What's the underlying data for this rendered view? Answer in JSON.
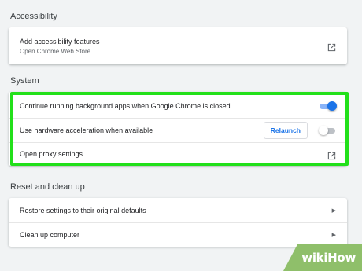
{
  "accessibility": {
    "heading": "Accessibility",
    "add_features": {
      "label": "Add accessibility features",
      "sublabel": "Open Chrome Web Store",
      "icon": "external-link-icon"
    }
  },
  "system": {
    "heading": "System",
    "background_apps": {
      "label": "Continue running background apps when Google Chrome is closed",
      "toggle": "on"
    },
    "hardware_acceleration": {
      "label": "Use hardware acceleration when available",
      "button_label": "Relaunch",
      "toggle": "off"
    },
    "proxy": {
      "label": "Open proxy settings",
      "icon": "external-link-icon"
    }
  },
  "reset": {
    "heading": "Reset and clean up",
    "restore": {
      "label": "Restore settings to their original defaults",
      "icon": "chevron-right-icon"
    },
    "cleanup": {
      "label": "Clean up computer",
      "icon": "chevron-right-icon"
    }
  },
  "watermark": {
    "text": "wikiHow"
  },
  "colors": {
    "accent": "#1a73e8",
    "highlight": "#22e01a",
    "background": "#f1f3f4",
    "watermark": "#8fbf6a"
  }
}
